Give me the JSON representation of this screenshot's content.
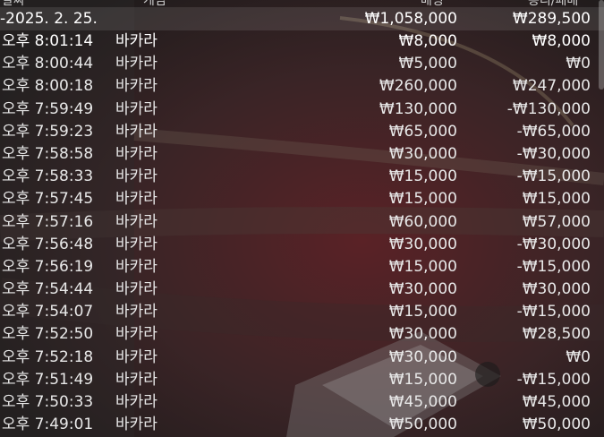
{
  "header": {
    "col_time": "날짜",
    "col_game": "게임",
    "col_bet": "배팅",
    "col_result": "승리/패배"
  },
  "date_group": {
    "label": "-2025. 2. 25.",
    "bet_total": "₩1,058,000",
    "result_total": "₩289,500"
  },
  "rows": [
    {
      "time": "오후 8:01:14",
      "game": "바카라",
      "bet": "₩8,000",
      "result": "₩8,000"
    },
    {
      "time": "오후 8:00:44",
      "game": "바카라",
      "bet": "₩5,000",
      "result": "₩0"
    },
    {
      "time": "오후 8:00:18",
      "game": "바카라",
      "bet": "₩260,000",
      "result": "₩247,000"
    },
    {
      "time": "오후 7:59:49",
      "game": "바카라",
      "bet": "₩130,000",
      "result": "-₩130,000"
    },
    {
      "time": "오후 7:59:23",
      "game": "바카라",
      "bet": "₩65,000",
      "result": "-₩65,000"
    },
    {
      "time": "오후 7:58:58",
      "game": "바카라",
      "bet": "₩30,000",
      "result": "-₩30,000"
    },
    {
      "time": "오후 7:58:33",
      "game": "바카라",
      "bet": "₩15,000",
      "result": "-₩15,000"
    },
    {
      "time": "오후 7:57:45",
      "game": "바카라",
      "bet": "₩15,000",
      "result": "₩15,000"
    },
    {
      "time": "오후 7:57:16",
      "game": "바카라",
      "bet": "₩60,000",
      "result": "₩57,000"
    },
    {
      "time": "오후 7:56:48",
      "game": "바카라",
      "bet": "₩30,000",
      "result": "-₩30,000"
    },
    {
      "time": "오후 7:56:19",
      "game": "바카라",
      "bet": "₩15,000",
      "result": "-₩15,000"
    },
    {
      "time": "오후 7:54:44",
      "game": "바카라",
      "bet": "₩30,000",
      "result": "₩30,000"
    },
    {
      "time": "오후 7:54:07",
      "game": "바카라",
      "bet": "₩15,000",
      "result": "-₩15,000"
    },
    {
      "time": "오후 7:52:50",
      "game": "바카라",
      "bet": "₩30,000",
      "result": "₩28,500"
    },
    {
      "time": "오후 7:52:18",
      "game": "바카라",
      "bet": "₩30,000",
      "result": "₩0"
    },
    {
      "time": "오후 7:51:49",
      "game": "바카라",
      "bet": "₩15,000",
      "result": "-₩15,000"
    },
    {
      "time": "오후 7:50:33",
      "game": "바카라",
      "bet": "₩45,000",
      "result": "₩45,000"
    },
    {
      "time": "오후 7:49:01",
      "game": "바카라",
      "bet": "₩50,000",
      "result": "₩50,000"
    }
  ]
}
